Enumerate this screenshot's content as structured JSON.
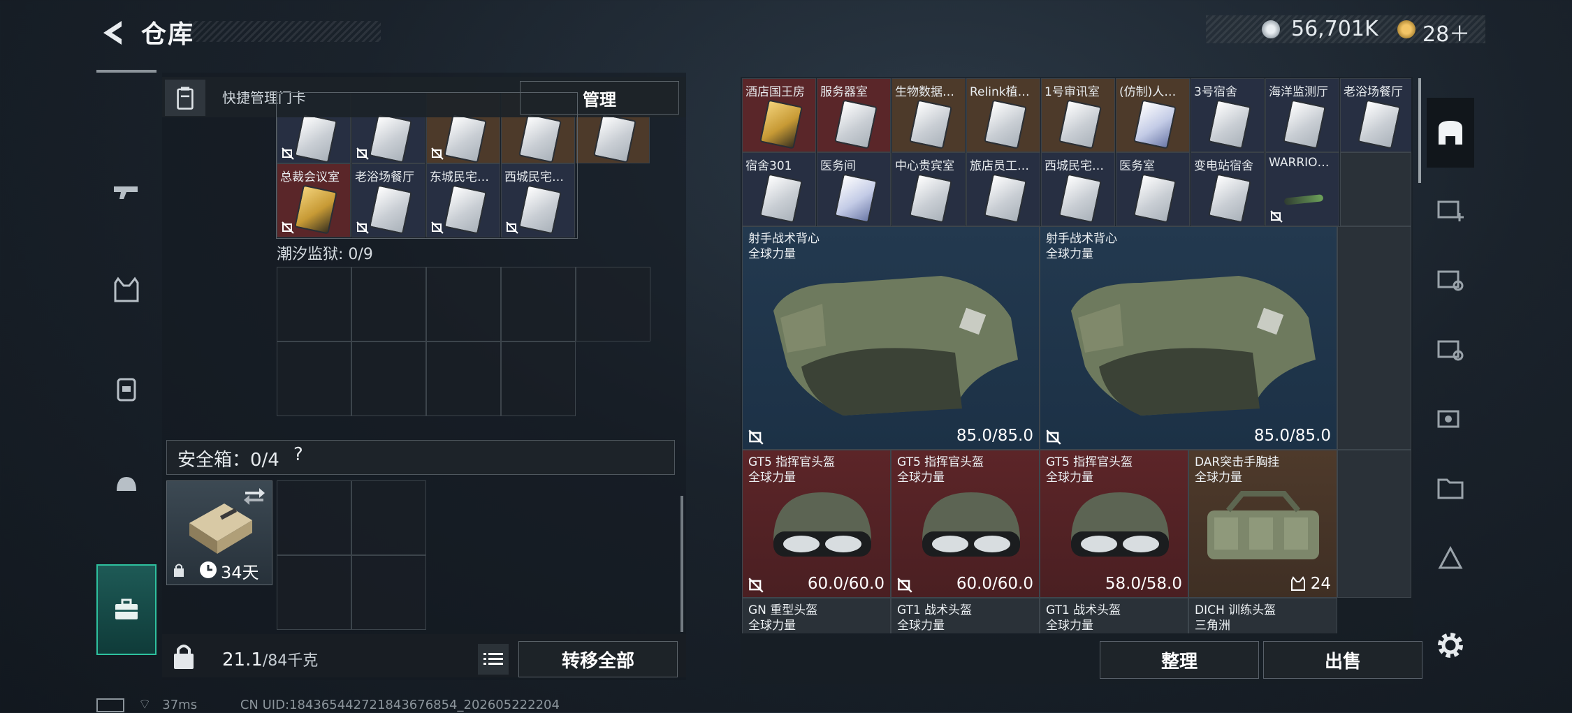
{
  "header": {
    "title": "仓库"
  },
  "currency": {
    "coins": "56,701K",
    "tickets": "28＋"
  },
  "quick_manage": {
    "label": "快捷管理门卡",
    "button": "管理"
  },
  "keycards": [
    {
      "name": "总裁会议室",
      "style": "gold",
      "bg": "bg-red"
    },
    {
      "name": "老浴场餐厅",
      "style": "white",
      "bg": "bg-navy"
    },
    {
      "name": "东城民宅…",
      "style": "white",
      "bg": "bg-navy"
    },
    {
      "name": "西城民宅…",
      "style": "white",
      "bg": "bg-navy"
    }
  ],
  "prison": {
    "label": "潮汐监狱: 0/9"
  },
  "safe": {
    "label": "安全箱：0/4",
    "help": "?",
    "days": "34天"
  },
  "footer_left": {
    "weight": "21.1",
    "capacity": "/84千克",
    "transfer": "转移全部"
  },
  "right_cards": [
    {
      "name": "酒店国王房",
      "style": "gold",
      "bg": "bg-red"
    },
    {
      "name": "服务器室",
      "style": "white",
      "bg": "bg-red"
    },
    {
      "name": "生物数据…",
      "style": "white",
      "bg": "bg-brown"
    },
    {
      "name": "Relink植…",
      "style": "white",
      "bg": "bg-brown"
    },
    {
      "name": "1号审讯室",
      "style": "white",
      "bg": "bg-brown"
    },
    {
      "name": "(仿制)人…",
      "style": "blue",
      "bg": "bg-brown"
    },
    {
      "name": "3号宿舍",
      "style": "white",
      "bg": "bg-navy"
    },
    {
      "name": "海洋监测厅",
      "style": "white",
      "bg": "bg-navy"
    },
    {
      "name": "老浴场餐厅",
      "style": "white",
      "bg": "bg-navy"
    },
    {
      "name": "宿舍301",
      "style": "white",
      "bg": "bg-navy"
    },
    {
      "name": "医务间",
      "style": "blue",
      "bg": "bg-navy"
    },
    {
      "name": "中心贵宾室",
      "style": "white",
      "bg": "bg-navy"
    },
    {
      "name": "旅店员工…",
      "style": "white",
      "bg": "bg-navy"
    },
    {
      "name": "西城民宅…",
      "style": "white",
      "bg": "bg-navy"
    },
    {
      "name": "医务室",
      "style": "white",
      "bg": "bg-navy"
    },
    {
      "name": "变电站宿舍",
      "style": "white",
      "bg": "bg-navy"
    },
    {
      "name": "WARRIO…",
      "style": "stick",
      "bg": "bg-navy"
    }
  ],
  "vests": [
    {
      "name": "射手战术背心",
      "sub": "全球力量",
      "durability": "85.0/85.0"
    },
    {
      "name": "射手战术背心",
      "sub": "全球力量",
      "durability": "85.0/85.0"
    }
  ],
  "helmets": [
    {
      "name": "GT5 指挥官头盔",
      "sub": "全球力量",
      "durability": "60.0/60.0"
    },
    {
      "name": "GT5 指挥官头盔",
      "sub": "全球力量",
      "durability": "60.0/60.0"
    },
    {
      "name": "GT5 指挥官头盔",
      "sub": "全球力量",
      "durability": "58.0/58.0"
    }
  ],
  "rig": {
    "name": "DAR突击手胸挂",
    "sub": "全球力量",
    "count": "24"
  },
  "bottom_row": [
    {
      "name": "GN 重型头盔",
      "sub": "全球力量"
    },
    {
      "name": "GT1 战术头盔",
      "sub": "全球力量"
    },
    {
      "name": "GT1 战术头盔",
      "sub": "全球力量"
    },
    {
      "name": "DICH 训练头盔",
      "sub": "三角洲"
    }
  ],
  "footer_right": {
    "sort": "整理",
    "sell": "出售"
  },
  "status": {
    "ping": "37ms",
    "uid": "CN UID:1843654427218436768​54_202605222204"
  }
}
